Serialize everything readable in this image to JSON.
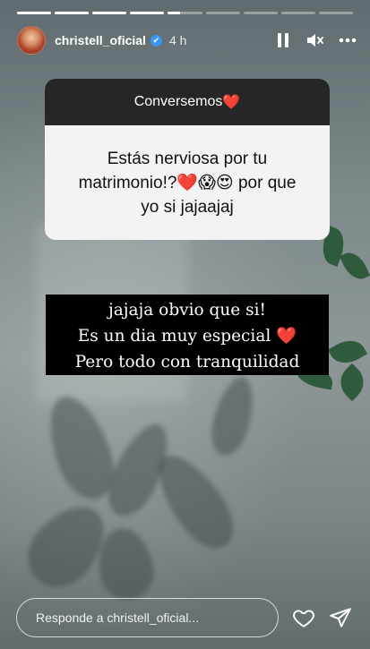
{
  "progress": {
    "segments": [
      1,
      1,
      1,
      1,
      0.35,
      0,
      0,
      0,
      0
    ]
  },
  "header": {
    "username": "christell_oficial",
    "verified_mark": "✔",
    "time": "4 h",
    "icons": [
      "pause-icon",
      "mute-icon",
      "more-icon"
    ]
  },
  "question": {
    "title": "Conversemos",
    "title_emoji": "❤️",
    "text_line1": "Estás nerviosa por tu",
    "text_line2": "matrimonio!?❤️😱😍 por que",
    "text_line3": "yo si jajaajaj"
  },
  "answer": {
    "line1": "jajaja obvio que si!",
    "line2": "Es un dia muy especial ❤️",
    "line3": "Pero todo con tranquilidad"
  },
  "reply": {
    "placeholder": "Responde a christell_oficial...",
    "icons": [
      "heart-icon",
      "send-icon"
    ]
  },
  "colors": {
    "card_header": "#262626",
    "card_body": "#f3f3f3",
    "heart": "#e8202a",
    "verified": "#3897f0"
  }
}
